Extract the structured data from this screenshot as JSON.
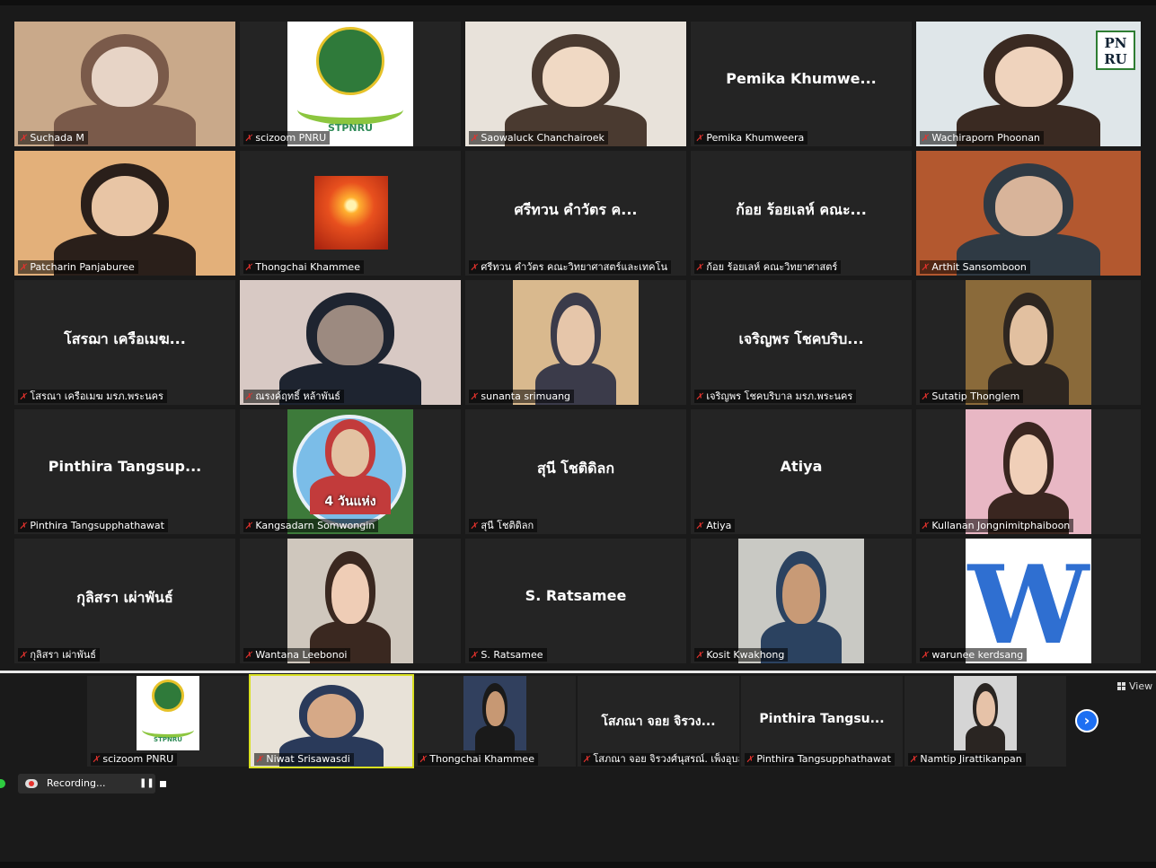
{
  "grid": [
    {
      "id": "t1",
      "name": "Suchada M",
      "type": "video",
      "colors": [
        "#c9a98a",
        "#7a5a4a",
        "#e7d4c6"
      ]
    },
    {
      "id": "t2",
      "name": "scizoom PNRU",
      "type": "logo",
      "logo_text": "STPNRU"
    },
    {
      "id": "t3",
      "name": "Saowaluck Chanchairoek",
      "type": "video",
      "colors": [
        "#e8e2da",
        "#4a3a30",
        "#f0d9c4"
      ]
    },
    {
      "id": "t4",
      "name": "Pemika Khumweera",
      "type": "text",
      "big": "Pemika  Khumwe..."
    },
    {
      "id": "t5",
      "name": "Wachiraporn Phoonan",
      "type": "video-active",
      "colors": [
        "#dfe6e9",
        "#3a2a22",
        "#efd3bd"
      ],
      "logo_text": "PN RU"
    },
    {
      "id": "t6",
      "name": "Patcharin Panjaburee",
      "type": "video",
      "colors": [
        "#e3b07a",
        "#2a1f1a",
        "#e8c5a5"
      ]
    },
    {
      "id": "t7",
      "name": "Thongchai Khammee",
      "type": "sunset",
      "muted": false
    },
    {
      "id": "t8",
      "name": "ศรีทวน  คำวัตร คณะวิทยาศาสตร์และเทคโน",
      "type": "text",
      "big": "ศรีทวน  คำวัตร ค..."
    },
    {
      "id": "t9",
      "name": "ก้อย ร้อยเลห์ คณะวิทยาศาสตร์",
      "type": "text",
      "big": "ก้อย  ร้อยเลห์ คณะ..."
    },
    {
      "id": "t10",
      "name": "Arthit Sansomboon",
      "type": "video",
      "colors": [
        "#b3582f",
        "#2f3a44",
        "#d8b49a"
      ]
    },
    {
      "id": "t11",
      "name": "โสรณา เครือเมฆ มรภ.พระนคร",
      "type": "text",
      "big": "โสรฌา เครือเมฆ..."
    },
    {
      "id": "t12",
      "name": "ณรงค์ฤทธิ์ หล้าพันธ์",
      "type": "video",
      "colors": [
        "#d8c9c4",
        "#1e2430",
        "#9c8a80"
      ]
    },
    {
      "id": "t13",
      "name": "sunanta srimuang",
      "type": "photo",
      "colors": [
        "#d9b98e",
        "#3b3b4a",
        "#e6c6aa"
      ]
    },
    {
      "id": "t14",
      "name": "เจริญพร โชคบริบาล มรภ.พระนคร",
      "type": "text",
      "big": "เจริญพร โชคบริบ..."
    },
    {
      "id": "t15",
      "name": "Sutatip Thonglem",
      "type": "photo",
      "colors": [
        "#8a6a3a",
        "#2e2620",
        "#e2c0a0"
      ]
    },
    {
      "id": "t16",
      "name": "Pinthira Tangsupphathawat",
      "type": "text",
      "big": "Pinthira  Tangsup..."
    },
    {
      "id": "t17",
      "name": "Kangsadarn Somwongin",
      "type": "photo-circle",
      "colors": [
        "#7bbde8",
        "#3d7a3a",
        "#c23b3b"
      ],
      "overlay_text": "4 วันแห่ง"
    },
    {
      "id": "t18",
      "name": "สุนี โชติดิลก",
      "type": "text",
      "big": "สุนี  โชติดิลก"
    },
    {
      "id": "t19",
      "name": "Atiya",
      "type": "text",
      "big": "Atiya"
    },
    {
      "id": "t20",
      "name": "Kullanan Jongnimitphaiboon",
      "type": "photo",
      "colors": [
        "#e8b7c4",
        "#3a2620",
        "#f0cfb8"
      ]
    },
    {
      "id": "t21",
      "name": "กุลิสรา เผ่าพันธ์",
      "type": "text",
      "big": "กุลิสรา  เผ่าพันธ์"
    },
    {
      "id": "t22",
      "name": "Wantana Leebonoi",
      "type": "photo",
      "colors": [
        "#cfc7bd",
        "#3a2820",
        "#efcdb6"
      ]
    },
    {
      "id": "t23",
      "name": "S. Ratsamee",
      "type": "text",
      "big": "S.  Ratsamee"
    },
    {
      "id": "t24",
      "name": "Kosit Kwakhong",
      "type": "photo",
      "colors": [
        "#c9c9c4",
        "#2b4260",
        "#c89a76"
      ]
    },
    {
      "id": "t25",
      "name": "warunee kerdsang",
      "type": "letter",
      "letter": "W"
    }
  ],
  "strip": [
    {
      "id": "s1",
      "name": "scizoom PNRU",
      "type": "logo",
      "logo_text": "STPNRU"
    },
    {
      "id": "s2",
      "name": "Niwat Srisawasdi",
      "type": "video-active",
      "colors": [
        "#e8e2d8",
        "#2a3a5a",
        "#d6a987"
      ]
    },
    {
      "id": "s3",
      "name": "Thongchai Khammee",
      "type": "photo",
      "colors": [
        "#31405e",
        "#1a1a1a",
        "#c79873"
      ]
    },
    {
      "id": "s4",
      "name": "โสภณา จอย จิรวงศ์นุสรณ์. เพ็งอุบล",
      "type": "text",
      "big": "โสภณา จอย จิรวง..."
    },
    {
      "id": "s5",
      "name": "Pinthira Tangsupphathawat",
      "type": "text",
      "big": "Pinthira  Tangsu..."
    },
    {
      "id": "s6",
      "name": "Namtip Jirattikanpan",
      "type": "photo",
      "colors": [
        "#d5d5d5",
        "#2a2522",
        "#e6c2a8"
      ]
    }
  ],
  "controls": {
    "view_label": "View",
    "recording_label": "Recording...",
    "pause_label": "❚❚",
    "next_label": "›"
  }
}
